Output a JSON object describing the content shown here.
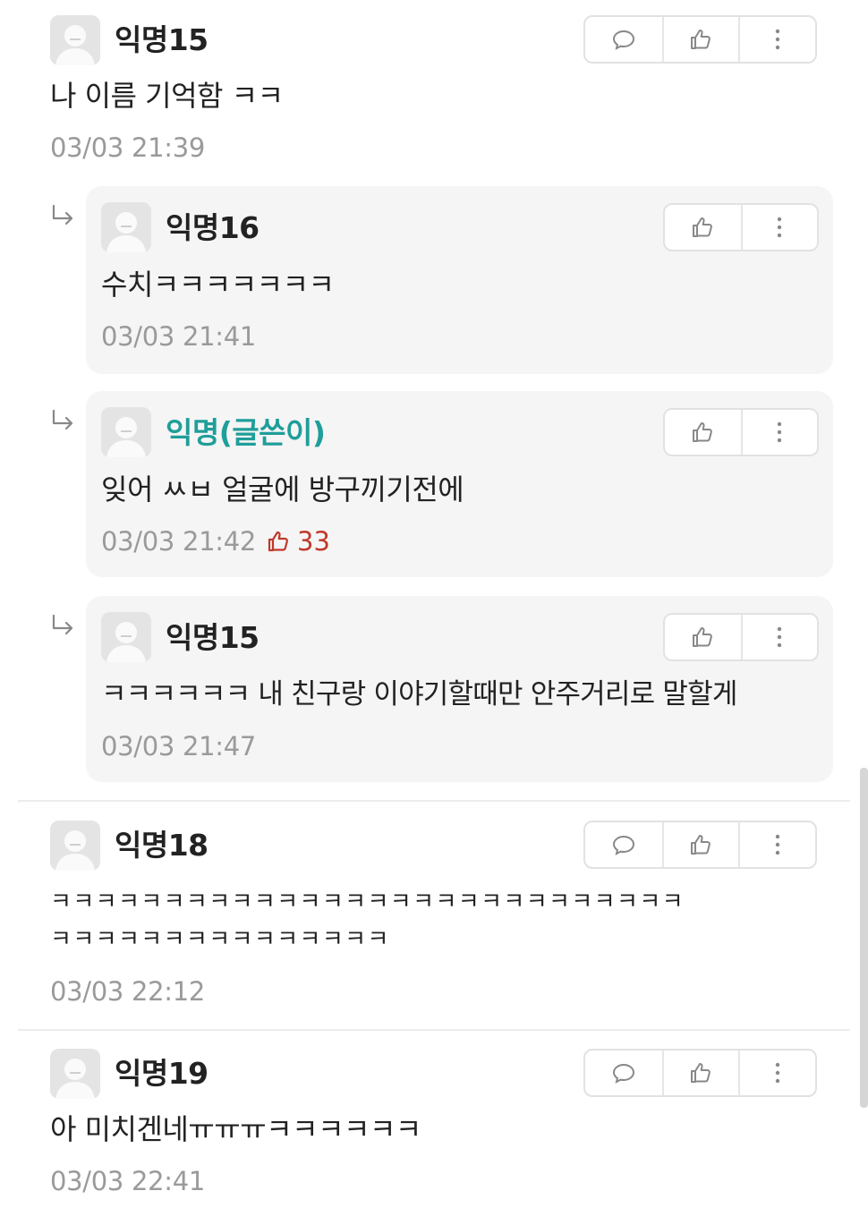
{
  "comments": [
    {
      "author": "익명15",
      "body": "나 이름 기억함 ㅋㅋ",
      "time": "03/03 21:39"
    },
    {
      "author": "익명16",
      "body": "수치ㅋㅋㅋㅋㅋㅋㅋ",
      "time": "03/03 21:41"
    },
    {
      "author": "익명(글쓴이)",
      "body": "잊어 ㅆㅂ 얼굴에 방구끼기전에",
      "time": "03/03 21:42",
      "likes": "33"
    },
    {
      "author": "익명15",
      "body": "ㅋㅋㅋㅋㅋㅋ 내 친구랑 이야기할때만 안주거리로 말할게",
      "time": "03/03 21:47"
    },
    {
      "author": "익명18",
      "body_line1": "ㅋㅋㅋㅋㅋㅋㅋㅋㅋㅋㅋㅋㅋㅋㅋㅋㅋㅋㅋㅋㅋㅋㅋㅋㅋㅋㅋㅋ",
      "body_line2": "ㅋㅋㅋㅋㅋㅋㅋㅋㅋㅋㅋㅋㅋㅋㅋ",
      "time": "03/03 22:12"
    },
    {
      "author": "익명19",
      "body": "아 미치겐네ㅠㅠㅠㅋㅋㅋㅋㅋㅋ",
      "time": "03/03 22:41"
    }
  ],
  "icons": {
    "reply": "speech-bubble-icon",
    "like": "thumbs-up-icon",
    "more": "vertical-dots-icon",
    "reply_indicator": "reply-arrow-icon",
    "avatar": "default-avatar-icon"
  },
  "colors": {
    "op_name": "#1f9e9a",
    "like_count": "#c0392b",
    "time": "#9a9a9a",
    "reply_background": "#f5f5f5"
  }
}
